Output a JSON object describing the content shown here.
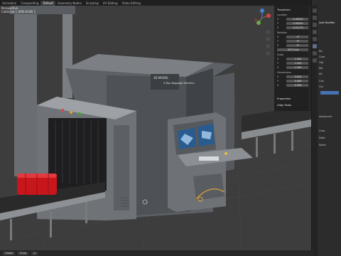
{
  "topbar": {
    "tabs": [
      "Animation",
      "Compositing",
      "Default",
      "Geometry Nodes",
      "Scripting",
      "UV Editing",
      "Video Editing"
    ],
    "active_tab": "Default",
    "scene_label": "Scene"
  },
  "viewport": {
    "view_name": "Perspective",
    "collection_label": "Collection | XRB HCB6 1",
    "machine_title": "X-Ray Baggage Machine",
    "machine_brand": "3D MODEL"
  },
  "n_panel": {
    "header": "Transform",
    "location_label": "Location",
    "location": {
      "x": "0.00000",
      "y": "0.00000",
      "z": "0.21173"
    },
    "rotation_label": "Rotation",
    "rotation": {
      "x": "0°",
      "y": "0°",
      "z": "0°"
    },
    "rotation_mode": "XYZ Euler",
    "scale_label": "Scale",
    "scale": {
      "x": "1.000",
      "y": "1.000",
      "z": "1.000"
    },
    "dimensions_label": "Dimensions",
    "dimensions": {
      "x": "0.834",
      "y": "0.489",
      "z": "0.358"
    },
    "properties_label": "Properties",
    "align_tools_label": "Align Tools",
    "axis_x": "X",
    "axis_y": "Y",
    "axis_z": "Z"
  },
  "properties_sidebar": {
    "add_modifier": "Add Modifier",
    "items": [
      "Re",
      "Com",
      "Obj",
      "Ma",
      "Ali",
      "Cos",
      "Col",
      "Advanced",
      "Crea",
      "Defo",
      "Selec"
    ]
  },
  "statusbar": {
    "pivot": "Global",
    "snap": "Snap"
  },
  "colors": {
    "accent": "#4772b3",
    "luggage": "#c8161c",
    "machine_gray": "#6b6f74",
    "belt_dark": "#2a2a2a"
  }
}
